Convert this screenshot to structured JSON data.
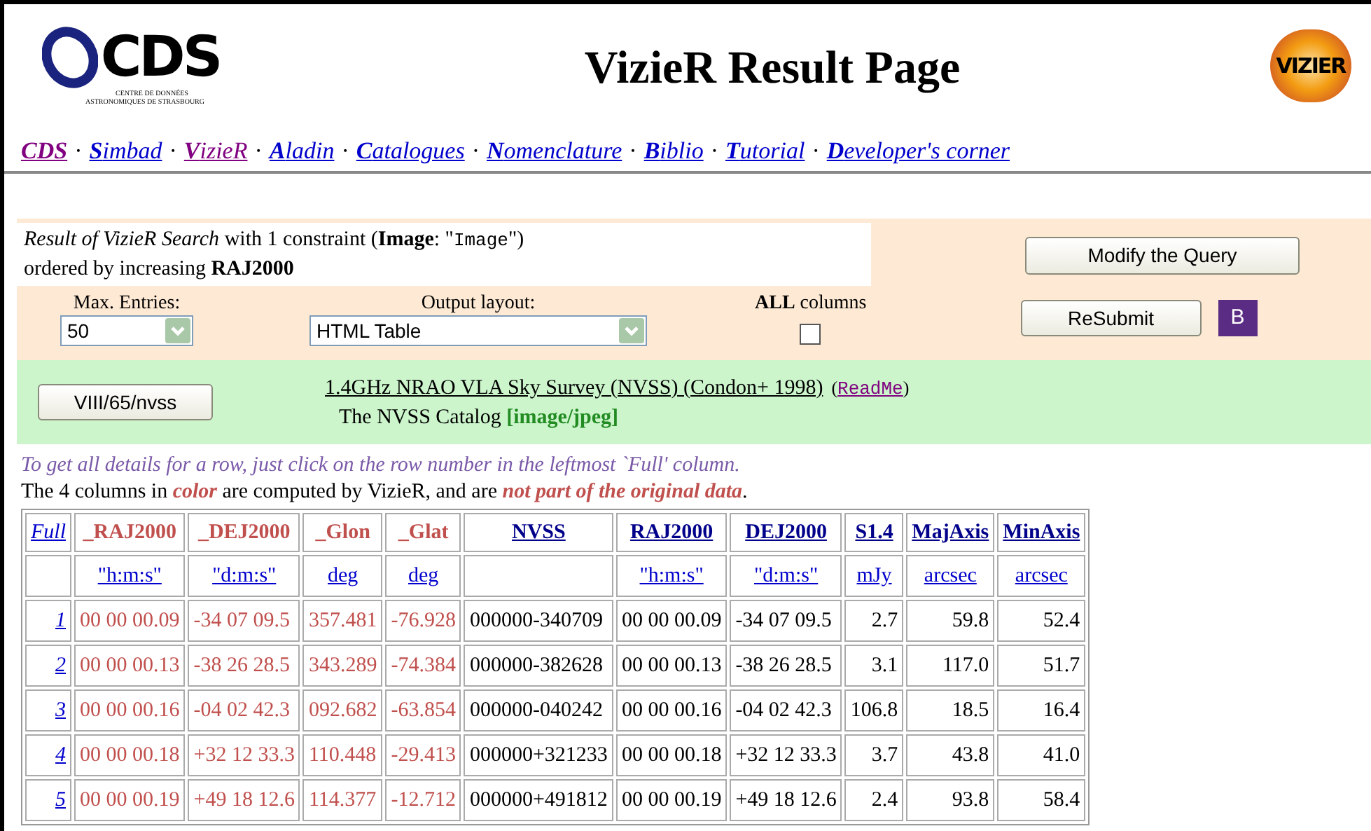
{
  "nav_separator": "·",
  "header": {
    "logo": {
      "text": "CDS",
      "line1": "CENTRE DE DONNÉES",
      "line2": "ASTRONOMIQUES DE STRASBOURG"
    },
    "title": "VizieR Result Page",
    "badge": "VIZIER"
  },
  "nav": [
    {
      "text": "CDS",
      "kind": "home",
      "visited": true
    },
    {
      "text": "**S**imbad",
      "kind": "link",
      "visited": false
    },
    {
      "text": "**V**izieR",
      "kind": "link",
      "visited": true
    },
    {
      "text": "**A**ladin",
      "kind": "link",
      "visited": false
    },
    {
      "text": "**C**atalogues",
      "kind": "link",
      "visited": false
    },
    {
      "text": "**N**omenclature",
      "kind": "link",
      "visited": false
    },
    {
      "text": "**B**iblio",
      "kind": "link",
      "visited": false
    },
    {
      "text": "**T**utorial",
      "kind": "link",
      "visited": false
    },
    {
      "text": "**D**eveloper's corner",
      "kind": "link",
      "visited": false
    }
  ],
  "query": {
    "line1": [
      {
        "text": "*Result of VizieR Search* with 1 constraint  (**Image**: \"",
        "kind": "text"
      },
      {
        "text": "Image",
        "kind": "code"
      },
      {
        "text": "\")",
        "kind": "text"
      }
    ],
    "line2": "ordered by increasing **RAJ2000**",
    "modify_button": "Modify the Query"
  },
  "form": {
    "max_entries": {
      "label": "Max. Entries:",
      "value": "50"
    },
    "output_layout": {
      "label": "Output layout:",
      "value": "HTML Table"
    },
    "all_columns": {
      "label": "**ALL** columns",
      "checked": false
    },
    "resubmit_button": "ReSubmit",
    "b_button": "B"
  },
  "catalog": {
    "button": "VIII/65/nvss",
    "title": "1.4GHz NRAO VLA Sky Survey (NVSS) (Condon+ 1998)",
    "readme": {
      "before": "(",
      "link": "ReadMe",
      "after": ")"
    },
    "subtitle": "The NVSS Catalog **[image/jpeg]**"
  },
  "notes": [
    "To get all details for a row, just click on the row number in the leftmost `Full' column.",
    "The 4 columns in *color* are computed by VizieR, and are *not part of the original data*."
  ],
  "table": {
    "columns": [
      {
        "name": "Full",
        "kind": "full"
      },
      {
        "name": "_RAJ2000",
        "unit": "\"h:m:s\"",
        "kind": "computed"
      },
      {
        "name": "_DEJ2000",
        "unit": "\"d:m:s\"",
        "kind": "computed"
      },
      {
        "name": "_Glon",
        "unit": "deg",
        "kind": "computed"
      },
      {
        "name": "_Glat",
        "unit": "deg",
        "kind": "computed"
      },
      {
        "name": "NVSS",
        "kind": "text"
      },
      {
        "name": "RAJ2000",
        "unit": "\"h:m:s\"",
        "kind": "text"
      },
      {
        "name": "DEJ2000",
        "unit": "\"d:m:s\"",
        "kind": "text"
      },
      {
        "name": "S1.4",
        "unit": "mJy",
        "kind": "num"
      },
      {
        "name": "MajAxis",
        "unit": "arcsec",
        "kind": "num"
      },
      {
        "name": "MinAxis",
        "unit": "arcsec",
        "kind": "num"
      }
    ],
    "rows": [
      [
        "1",
        "00 00 00.09",
        "-34 07 09.5",
        "357.481",
        "-76.928",
        "000000-340709",
        "00 00 00.09",
        "-34 07 09.5",
        "2.7",
        "59.8",
        "52.4"
      ],
      [
        "2",
        "00 00 00.13",
        "-38 26 28.5",
        "343.289",
        "-74.384",
        "000000-382628",
        "00 00 00.13",
        "-38 26 28.5",
        "3.1",
        "117.0",
        "51.7"
      ],
      [
        "3",
        "00 00 00.16",
        "-04 02 42.3",
        "092.682",
        "-63.854",
        "000000-040242",
        "00 00 00.16",
        "-04 02 42.3",
        "106.8",
        "18.5",
        "16.4"
      ],
      [
        "4",
        "00 00 00.18",
        "+32 12 33.3",
        "110.448",
        "-29.413",
        "000000+321233",
        "00 00 00.18",
        "+32 12 33.3",
        "3.7",
        "43.8",
        "41.0"
      ],
      [
        "5",
        "00 00 00.19",
        "+49 18 12.6",
        "114.377",
        "-12.712",
        "000000+491812",
        "00 00 00.19",
        "+49 18 12.6",
        "2.4",
        "93.8",
        "58.4"
      ]
    ]
  }
}
